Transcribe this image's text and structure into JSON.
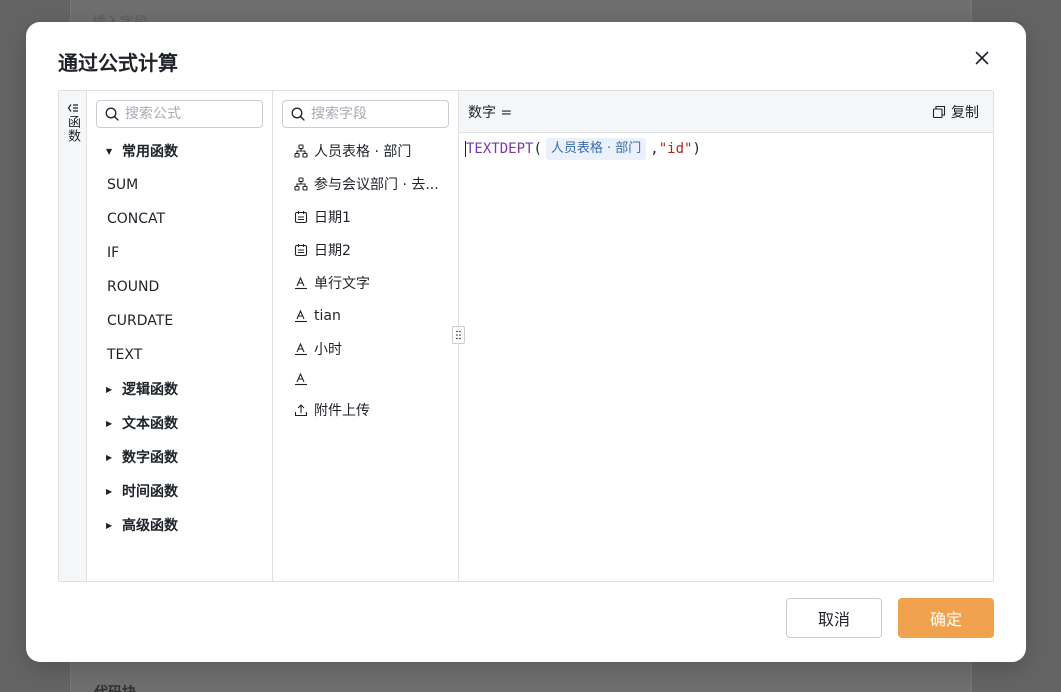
{
  "background": {
    "top_text": "插入字段",
    "bottom_text": "代码块"
  },
  "dialog": {
    "title": "通过公式计算",
    "close_icon": "close-icon"
  },
  "sidebar_toggle": {
    "icon": "collapse-left-icon",
    "label": "函数"
  },
  "functions": {
    "search_placeholder": "搜索公式",
    "groups": [
      {
        "label": "常用函数",
        "expanded": true,
        "items": [
          "SUM",
          "CONCAT",
          "IF",
          "ROUND",
          "CURDATE",
          "TEXT"
        ]
      },
      {
        "label": "逻辑函数",
        "expanded": false
      },
      {
        "label": "文本函数",
        "expanded": false
      },
      {
        "label": "数字函数",
        "expanded": false
      },
      {
        "label": "时间函数",
        "expanded": false
      },
      {
        "label": "高级函数",
        "expanded": false
      }
    ]
  },
  "fields": {
    "search_placeholder": "搜索字段",
    "items": [
      {
        "icon": "org-icon",
        "label": "人员表格 · 部门"
      },
      {
        "icon": "org-icon",
        "label": "参与会议部门 · 去..."
      },
      {
        "icon": "calendar-icon",
        "label": "日期1"
      },
      {
        "icon": "calendar-icon",
        "label": "日期2"
      },
      {
        "icon": "text-icon",
        "label": "单行文字"
      },
      {
        "icon": "text-icon",
        "label": "tian"
      },
      {
        "icon": "text-icon",
        "label": "小时"
      },
      {
        "icon": "text-icon",
        "label": ""
      },
      {
        "icon": "upload-icon",
        "label": "附件上传"
      }
    ]
  },
  "editor": {
    "header_label": "数字 =",
    "copy_label": "复制",
    "formula": {
      "function": "TEXTDEPT",
      "open_paren": "(",
      "field_tag": "人员表格 · 部门",
      "comma": ",",
      "string_arg": "\"id\"",
      "close_paren": ")"
    }
  },
  "footer": {
    "cancel_label": "取消",
    "ok_label": "确定"
  },
  "colors": {
    "primary": "#f0a24e",
    "tag_bg": "#eaf1fb",
    "tag_text": "#3b6ea8",
    "keyword": "#7a3aa0",
    "string": "#b3261e"
  }
}
